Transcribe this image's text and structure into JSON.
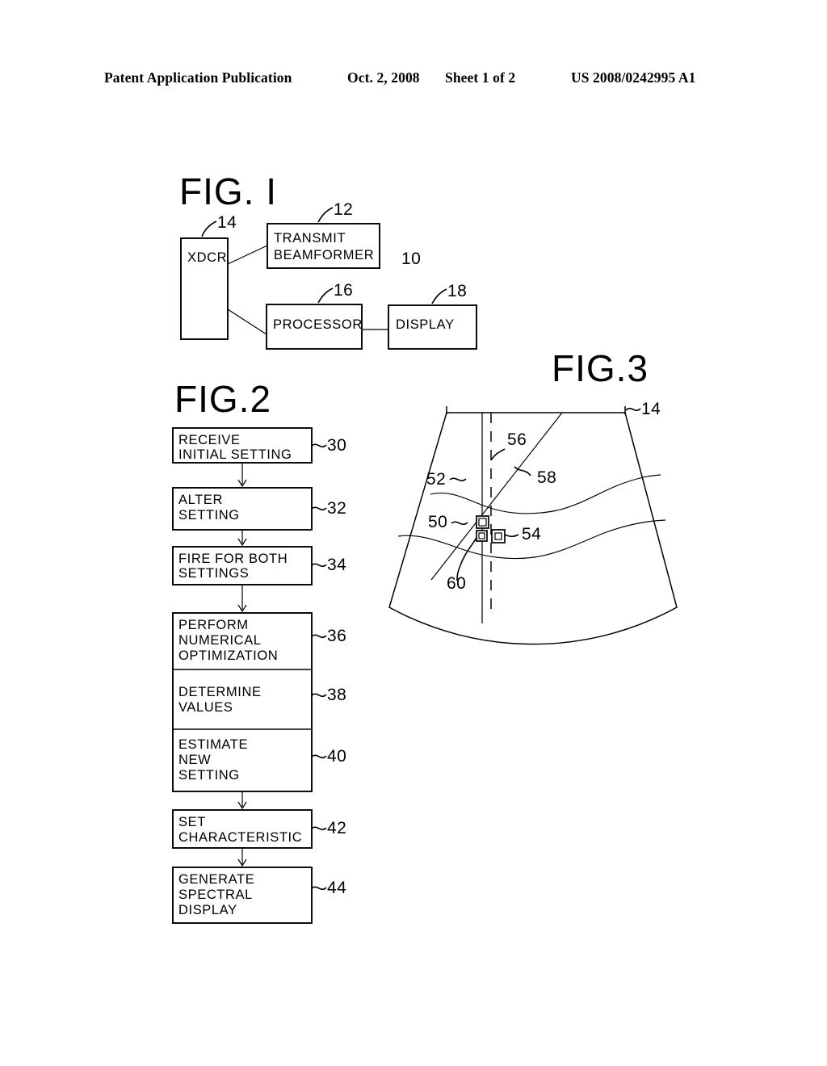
{
  "header": {
    "publication": "Patent Application Publication",
    "date": "Oct. 2, 2008",
    "sheet": "Sheet 1 of 2",
    "patent_number": "US 2008/0242995 A1"
  },
  "figure1": {
    "title": "FIG. I",
    "system_ref": "10",
    "blocks": [
      {
        "label": "XDCR",
        "ref": "14"
      },
      {
        "label_line1": "TRANSMIT",
        "label_line2": "BEAMFORMER",
        "ref": "12"
      },
      {
        "label": "PROCESSOR",
        "ref": "16"
      },
      {
        "label": "DISPLAY",
        "ref": "18"
      }
    ]
  },
  "figure2": {
    "title": "FIG.2",
    "steps": [
      {
        "ref": "30",
        "lines": [
          "RECEIVE",
          "INITIAL  SETTING"
        ]
      },
      {
        "ref": "32",
        "lines": [
          "ALTER",
          "SETTING"
        ]
      },
      {
        "ref": "34",
        "lines": [
          "FIRE FOR BOTH",
          "SETTINGS"
        ]
      },
      {
        "ref": "36",
        "lines": [
          "PERFORM",
          "NUMERICAL",
          "OPTIMIZATION"
        ]
      },
      {
        "ref": "38",
        "lines": [
          "DETERMINE",
          "VALUES"
        ]
      },
      {
        "ref": "40",
        "lines": [
          "ESTIMATE",
          "NEW",
          "SETTING"
        ]
      },
      {
        "ref": "42",
        "lines": [
          "SET",
          "CHARACTERISTIC"
        ]
      },
      {
        "ref": "44",
        "lines": [
          "GENERATE",
          "SPECTRAL",
          "DISPLAY"
        ]
      }
    ]
  },
  "figure3": {
    "title": "FIG.3",
    "refs": {
      "transducer": "14",
      "region": "52",
      "gate_a": "50",
      "gate_b": "54",
      "dashed_line": "56",
      "steer_line": "58",
      "gate_c": "60"
    }
  }
}
